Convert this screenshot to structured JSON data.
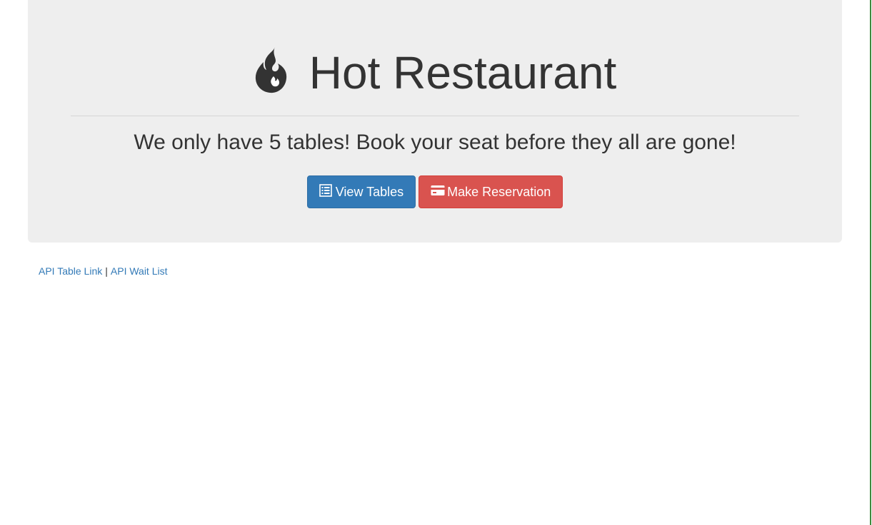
{
  "header": {
    "title": "Hot Restaurant",
    "title_icon": "fire-icon",
    "subtitle": "We only have 5 tables! Book your seat before they all are gone!"
  },
  "buttons": {
    "view_tables": {
      "label": "View Tables",
      "icon": "list-icon",
      "color": "#337ab7"
    },
    "make_reservation": {
      "label": "Make Reservation",
      "icon": "credit-card-icon",
      "color": "#d9534f"
    }
  },
  "footer_links": {
    "api_table": "API Table Link",
    "separator": "|",
    "api_wait": "API Wait List"
  },
  "colors": {
    "jumbotron_bg": "#eeeeee",
    "link": "#337ab7"
  }
}
